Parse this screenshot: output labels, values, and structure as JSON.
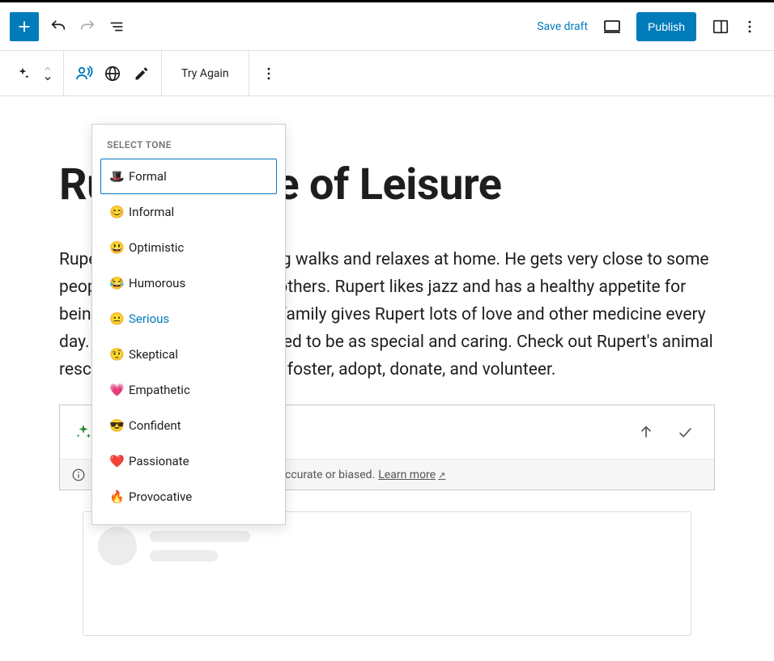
{
  "top": {
    "save_draft": "Save draft",
    "publish": "Publish"
  },
  "sec": {
    "try_again": "Try Again"
  },
  "doc": {
    "title": "Rupert's Life of Leisure",
    "body": "Rupert is a dog who takes long walks and relaxes at home. He gets very close to some people and is a diva towards others. Rupert likes jazz and has a healthy appetite for being a senior with IVDD. His family gives Rupert lots of love and other medicine every day. They didn't know dogs used to be as special and caring. Check out Rupert's animal rescue and learn how you can foster, adopt, donate, and volunteer."
  },
  "ai": {
    "disclaimer_tail": "ccurate or biased. ",
    "learn_more": "Learn more"
  },
  "tone": {
    "heading": "SELECT TONE",
    "items": [
      {
        "emoji": "🎩",
        "label": "Formal"
      },
      {
        "emoji": "😊",
        "label": "Informal"
      },
      {
        "emoji": "😃",
        "label": "Optimistic"
      },
      {
        "emoji": "😂",
        "label": "Humorous"
      },
      {
        "emoji": "😐",
        "label": "Serious"
      },
      {
        "emoji": "🤨",
        "label": "Skeptical"
      },
      {
        "emoji": "💗",
        "label": "Empathetic"
      },
      {
        "emoji": "😎",
        "label": "Confident"
      },
      {
        "emoji": "❤️",
        "label": "Passionate"
      },
      {
        "emoji": "🔥",
        "label": "Provocative"
      }
    ],
    "focused_index": 0,
    "selected_index": 4
  }
}
